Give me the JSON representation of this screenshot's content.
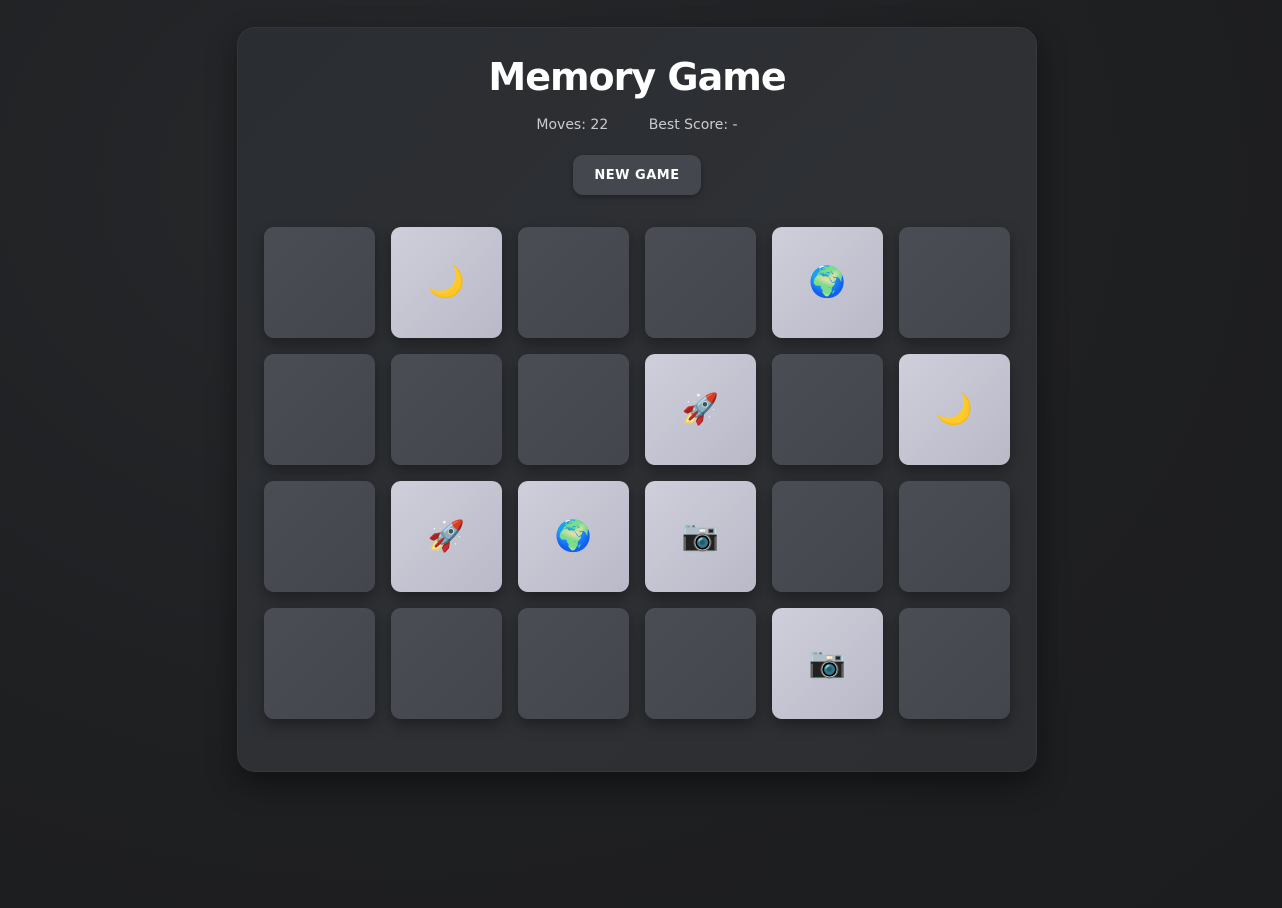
{
  "title": "Memory Game",
  "stats": {
    "moves_label": "Moves:",
    "moves_value": "22",
    "best_label": "Best Score:",
    "best_value": "-"
  },
  "new_game_label": "NEW GAME",
  "cards": [
    {
      "face_up": false,
      "icon": "",
      "icon_name": ""
    },
    {
      "face_up": true,
      "icon": "🌙",
      "icon_name": "moon-icon"
    },
    {
      "face_up": false,
      "icon": "",
      "icon_name": ""
    },
    {
      "face_up": false,
      "icon": "",
      "icon_name": ""
    },
    {
      "face_up": true,
      "icon": "🌍",
      "icon_name": "globe-icon"
    },
    {
      "face_up": false,
      "icon": "",
      "icon_name": ""
    },
    {
      "face_up": false,
      "icon": "",
      "icon_name": ""
    },
    {
      "face_up": false,
      "icon": "",
      "icon_name": ""
    },
    {
      "face_up": false,
      "icon": "",
      "icon_name": ""
    },
    {
      "face_up": true,
      "icon": "🚀",
      "icon_name": "rocket-icon"
    },
    {
      "face_up": false,
      "icon": "",
      "icon_name": ""
    },
    {
      "face_up": true,
      "icon": "🌙",
      "icon_name": "moon-icon"
    },
    {
      "face_up": false,
      "icon": "",
      "icon_name": ""
    },
    {
      "face_up": true,
      "icon": "🚀",
      "icon_name": "rocket-icon"
    },
    {
      "face_up": true,
      "icon": "🌍",
      "icon_name": "globe-icon"
    },
    {
      "face_up": true,
      "icon": "📷",
      "icon_name": "camera-icon"
    },
    {
      "face_up": false,
      "icon": "",
      "icon_name": ""
    },
    {
      "face_up": false,
      "icon": "",
      "icon_name": ""
    },
    {
      "face_up": false,
      "icon": "",
      "icon_name": ""
    },
    {
      "face_up": false,
      "icon": "",
      "icon_name": ""
    },
    {
      "face_up": false,
      "icon": "",
      "icon_name": ""
    },
    {
      "face_up": false,
      "icon": "",
      "icon_name": ""
    },
    {
      "face_up": true,
      "icon": "📷",
      "icon_name": "camera-icon"
    },
    {
      "face_up": false,
      "icon": "",
      "icon_name": ""
    }
  ]
}
